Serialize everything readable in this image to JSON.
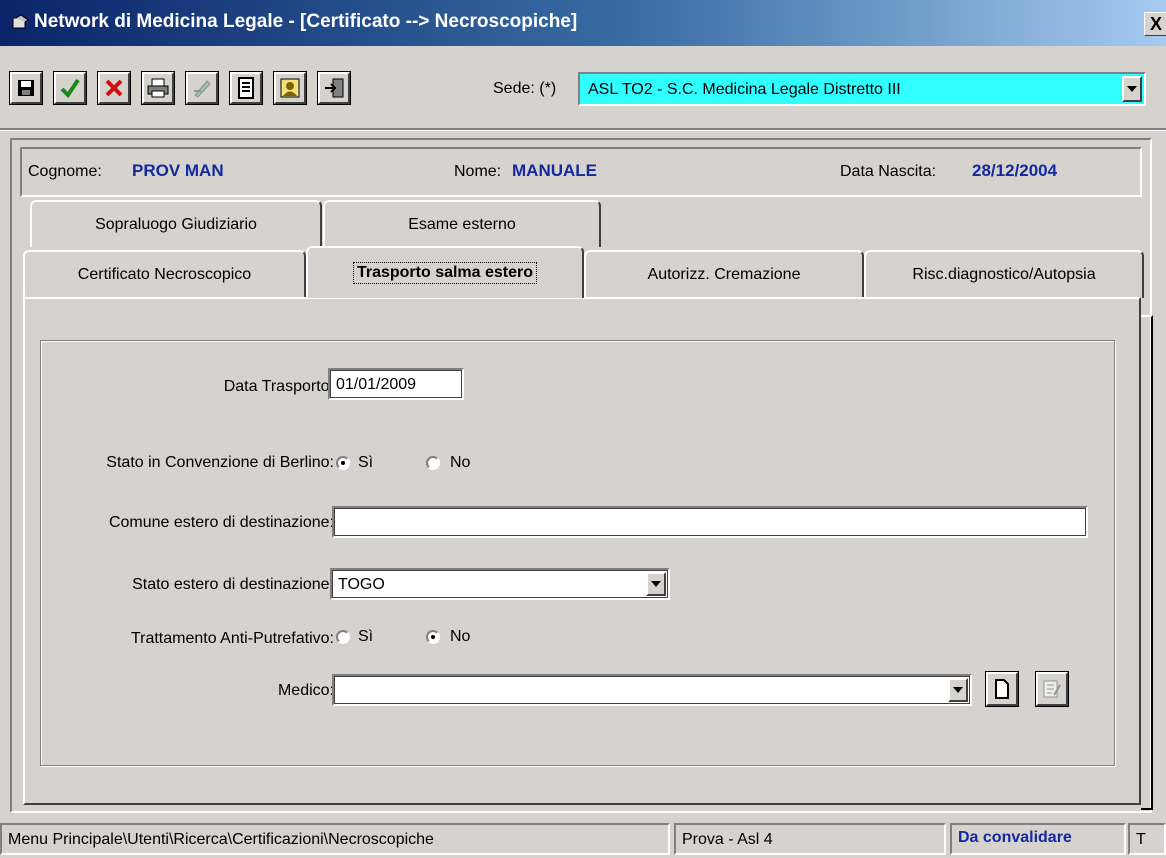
{
  "window": {
    "title": "Network di Medicina Legale - [Certificato --> Necroscopiche]",
    "close_label": "X"
  },
  "toolbar": {
    "buttons": [
      {
        "name": "save-button",
        "glyph": "💾",
        "color": "#000000"
      },
      {
        "name": "confirm-button",
        "glyph": "✔",
        "color": "#1a8a1a"
      },
      {
        "name": "cancel-button",
        "glyph": "✖",
        "color": "#d01010"
      },
      {
        "name": "print-button",
        "glyph": "🖶",
        "color": "#000000"
      },
      {
        "name": "disabled-tool-button",
        "glyph": "✎",
        "color": "#8a9a8a"
      },
      {
        "name": "document-button",
        "glyph": "📄",
        "color": "#000000"
      },
      {
        "name": "user-button",
        "glyph": "👤",
        "color": "#806000"
      },
      {
        "name": "exit-button",
        "glyph": "⇥",
        "color": "#000000"
      }
    ],
    "sede_label": "Sede: (*)",
    "sede_value": "ASL TO2 - S.C. Medicina Legale Distretto III"
  },
  "patient": {
    "surname_label": "Cognome:",
    "surname": "PROV MAN",
    "name_label": "Nome:",
    "name": "MANUALE",
    "birth_label": "Data Nascita:",
    "birth": "28/12/2004"
  },
  "tabs_row1": [
    "Sopraluogo Giudiziario",
    "Esame esterno"
  ],
  "tabs_row2": [
    "Certificato Necroscopico",
    "Trasporto salma estero",
    "Autorizz. Cremazione",
    "Risc.diagnostico/Autopsia"
  ],
  "form": {
    "date_label": "Data Trasporto:",
    "date_value": "01/01/2009",
    "berlin_label": "Stato in Convenzione di Berlino:",
    "yes": "Sì",
    "no": "No",
    "berlin_value": "Sì",
    "city_label": "Comune estero di destinazione:",
    "city_value": "",
    "country_label": "Stato estero di destinazione:",
    "country_value": "TOGO",
    "treatment_label": "Trattamento Anti-Putrefativo:",
    "treatment_value": "No",
    "doctor_label": "Medico:",
    "doctor_value": ""
  },
  "status": {
    "path": "Menu Principale\\Utenti\\Ricerca\\Certificazioni\\Necroscopiche",
    "user": "Prova - Asl 4",
    "state": "Da convalidare",
    "extra": "T"
  },
  "colors": {
    "title_bar": "#0a246a",
    "sede_bg": "#31ffff",
    "patient_value": "#1428a0",
    "status_state": "#1428a0"
  }
}
